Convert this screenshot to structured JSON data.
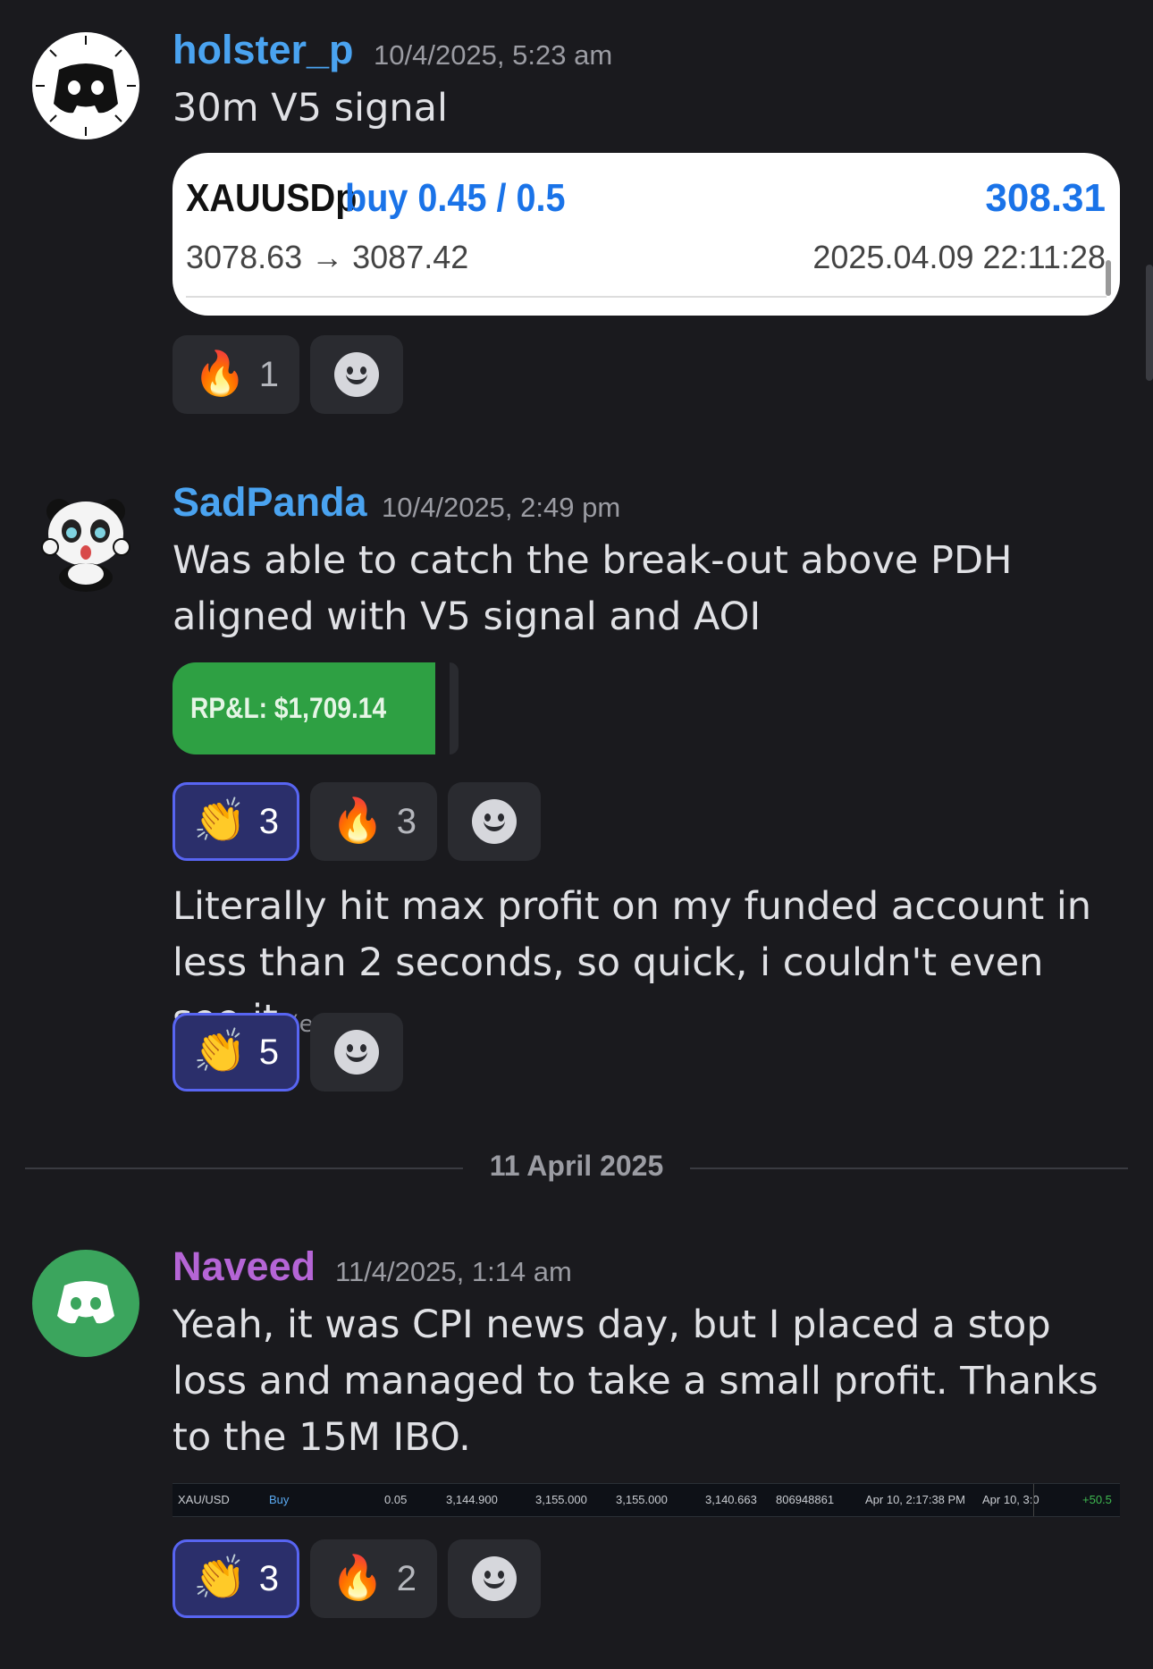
{
  "messages": [
    {
      "author": "holster_p",
      "author_color": "#4aa3f0",
      "timestamp": "10/4/2025, 5:23 am",
      "text": "30m V5 signal",
      "embed": {
        "symbol": "XAUUSDp",
        "side": "buy 0.45 / 0.5",
        "profit": "308.31",
        "prices": "3078.63 → 3087.42",
        "time": "2025.04.09 22:11:28"
      },
      "reactions": [
        {
          "emoji": "🔥",
          "count": "1",
          "me": false
        }
      ]
    },
    {
      "author": "SadPanda",
      "author_color": "#4aa3f0",
      "timestamp": "10/4/2025, 2:49 pm",
      "text": "Was able to catch the break-out above PDH aligned with V5 signal and AOI",
      "image_text": "RP&L: $1,709.14",
      "reactions": [
        {
          "emoji": "👏",
          "count": "3",
          "me": true
        },
        {
          "emoji": "🔥",
          "count": "3",
          "me": false
        }
      ],
      "followup": {
        "text": "Literally hit max profit on my funded account in less than 2 seconds, so quick, i couldn't even see it",
        "edited": "(edited)",
        "reactions": [
          {
            "emoji": "👏",
            "count": "5",
            "me": true
          }
        ]
      }
    },
    {
      "author": "Naveed",
      "author_color": "#b565d6",
      "timestamp": "11/4/2025, 1:14 am",
      "text": "Yeah, it was CPI news day, but I placed a stop loss and managed to take a small profit. Thanks to the 15M IBO.",
      "trade_row": {
        "symbol": "XAU/USD",
        "side": "Buy",
        "qty": "0.05",
        "open": "3,144.900",
        "tp": "3,155.000",
        "close": "3,155.000",
        "sl": "3,140.663",
        "id": "806948861",
        "open_time": "Apr 10, 2:17:38 PM",
        "close_time": "Apr 10, 3:0",
        "pnl": "+50.5"
      },
      "reactions": [
        {
          "emoji": "👏",
          "count": "3",
          "me": true
        },
        {
          "emoji": "🔥",
          "count": "2",
          "me": false
        }
      ]
    }
  ],
  "date_divider": "11 April 2025",
  "colors": {
    "background": "#1a1a1e",
    "reaction_me_bg": "#2b2f6b",
    "reaction_me_border": "#5865f2",
    "pnl_green": "#2ea043"
  }
}
